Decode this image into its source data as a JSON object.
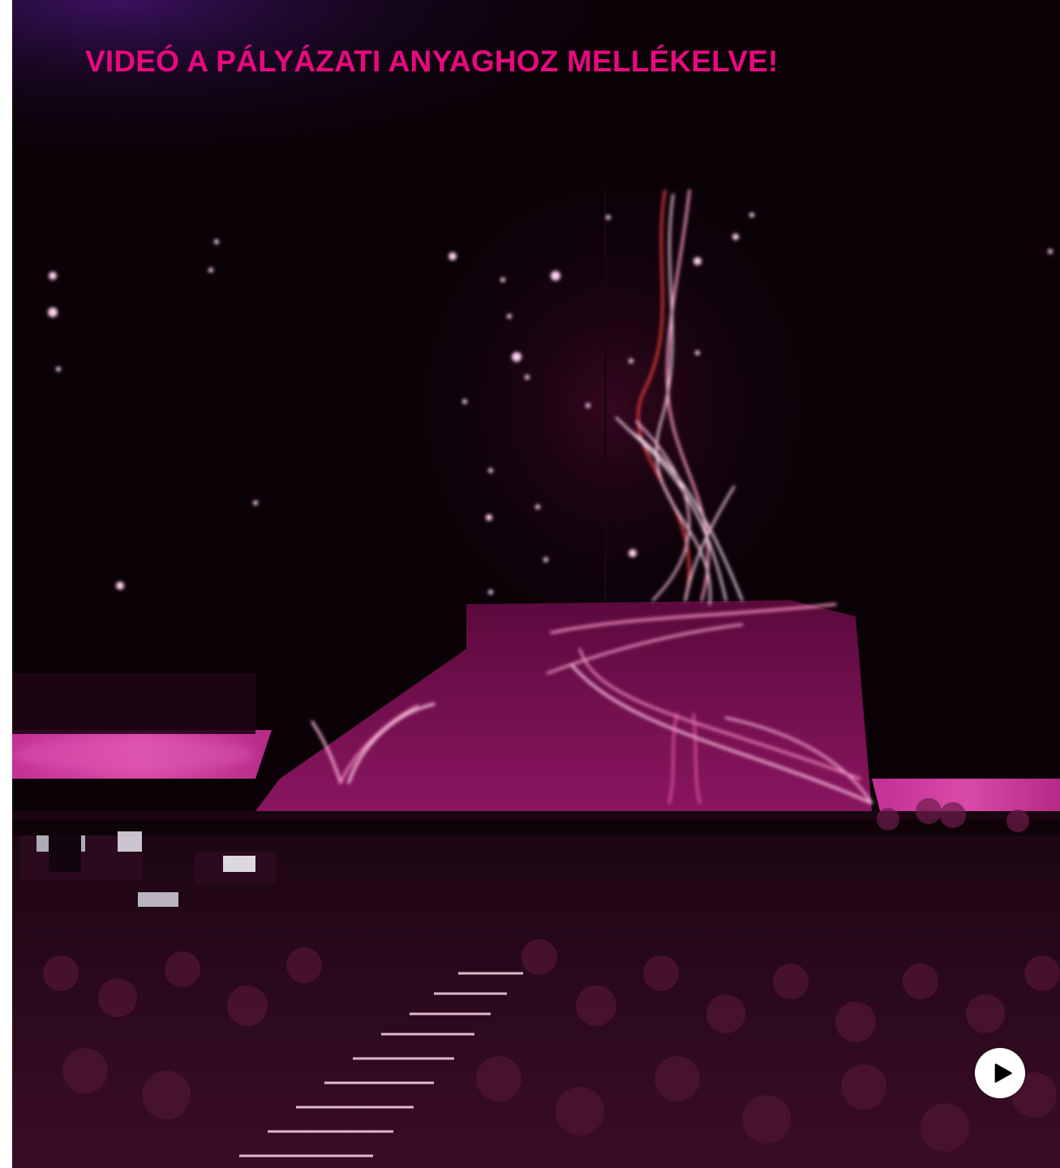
{
  "overlay": {
    "caption": "VIDEÓ A PÁLYÁZATI ANYAGHOZ MELLÉKELVE!",
    "caption_color": "#e8097e"
  },
  "media": {
    "icon": "play-icon"
  },
  "colors": {
    "background": "#0b0208",
    "stage_magenta": "#b0186e",
    "light_streak": "#ff9ac8",
    "red_streak": "#e83a3a"
  }
}
